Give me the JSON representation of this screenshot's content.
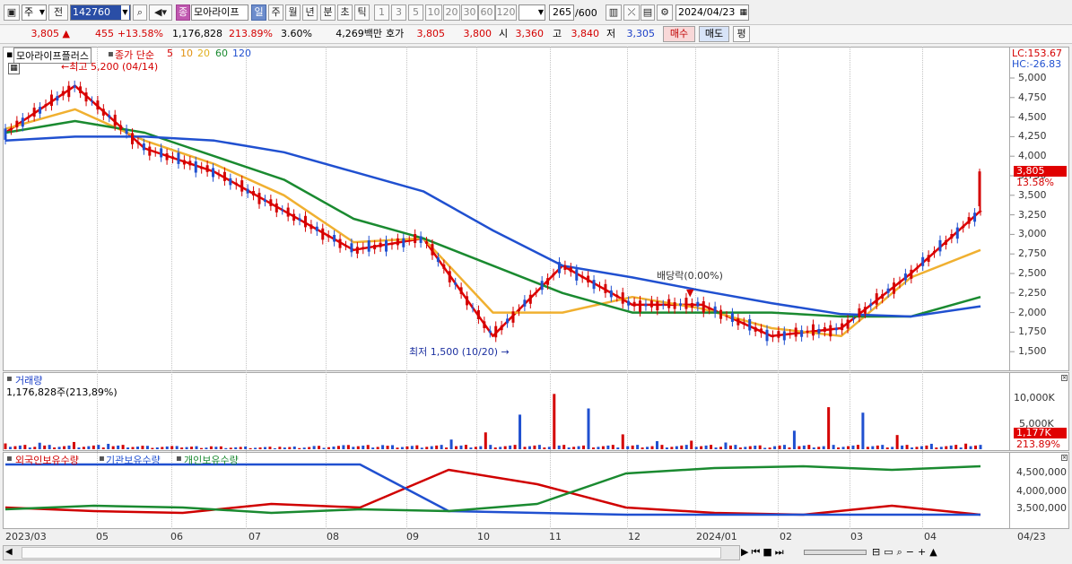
{
  "toolbar": {
    "period_select": "주",
    "prev_label": "전",
    "code": "142760",
    "name": "모아라이프",
    "badge": "종",
    "periods": [
      "일",
      "주",
      "월",
      "년",
      "분",
      "초",
      "틱"
    ],
    "intervals": [
      "1",
      "3",
      "5",
      "10",
      "20",
      "30",
      "60",
      "120"
    ],
    "count": "265",
    "count_total": "/600",
    "date": "2024/04/23"
  },
  "quote": {
    "price": "3,805",
    "change_arrow": "▲",
    "change": "455",
    "change_pct": "+13.58%",
    "volume": "1,176,828",
    "vol_ratio": "213.89%",
    "turnover": "3.60%",
    "amount": "4,269백만",
    "ask_label": "호가",
    "ask": "3,805",
    "bid": "3,800",
    "open_label": "시",
    "open": "3,360",
    "high_label": "고",
    "high": "3,840",
    "low_label": "저",
    "low": "3,305",
    "buy_label": "매수",
    "sell_label": "매도",
    "eval_label": "평"
  },
  "main_chart": {
    "name_tag": "모아라이프플러스",
    "legend": "종가 단순",
    "ma_labels": [
      "5",
      "10",
      "20",
      "60",
      "120"
    ],
    "ma_colors": [
      "#e00000",
      "#f0a020",
      "#f0b030",
      "#1a8a30",
      "#2050d0"
    ],
    "lc": "LC:153.67",
    "hc": "HC:-26.83",
    "annot_high": "최고 5,200 (04/14)",
    "annot_low": "최저 1,500 (10/20)",
    "annot_div": "배당락(0.00%)",
    "price_tag": "3,805",
    "price_pct": "13.58%",
    "yticks": [
      "5,000",
      "4,750",
      "4,500",
      "4,250",
      "4,000",
      "3,750",
      "3,500",
      "3,250",
      "3,000",
      "2,750",
      "2,500",
      "2,250",
      "2,000",
      "1,750",
      "1,500"
    ]
  },
  "volume_chart": {
    "title": "거래량",
    "value": "1,176,828주(213,89%)",
    "yticks": [
      "10,000K",
      "5,000K"
    ],
    "tag": "1,177K",
    "tag_pct": "213.89%"
  },
  "holding_chart": {
    "legend": [
      "외국인보유수량",
      "기관보유수량",
      "개인보유수량"
    ],
    "legend_colors": [
      "#d00000",
      "#2050d0",
      "#1a8a30"
    ],
    "yticks": [
      "4,500,000",
      "4,000,000",
      "3,500,000"
    ]
  },
  "x_labels": [
    "2023/03",
    "05",
    "06",
    "07",
    "08",
    "09",
    "10",
    "11",
    "12",
    "2024/01",
    "02",
    "03",
    "04"
  ],
  "x_end": "04/23",
  "chart_data": [
    {
      "type": "line",
      "title": "",
      "x": [
        "2023/03",
        "2023/04",
        "2023/05",
        "2023/06",
        "2023/07",
        "2023/08",
        "2023/09",
        "2023/10",
        "2023/11",
        "2023/12",
        "2024/01",
        "2024/02",
        "2024/03",
        "2024/04",
        "2024/04/23"
      ],
      "series": [
        {
          "name": "5",
          "values": [
            4300,
            4900,
            4100,
            3800,
            3300,
            2800,
            2950,
            1700,
            2600,
            2100,
            2100,
            1700,
            1800,
            2500,
            3300
          ]
        },
        {
          "name": "20",
          "values": [
            4350,
            4600,
            4200,
            3900,
            3500,
            2900,
            2950,
            2000,
            2000,
            2200,
            2050,
            1800,
            1700,
            2450,
            2800
          ]
        },
        {
          "name": "60",
          "values": [
            4300,
            4450,
            4300,
            4000,
            3700,
            3200,
            2950,
            2600,
            2250,
            2000,
            2000,
            2000,
            1950,
            1950,
            2200
          ]
        },
        {
          "name": "120",
          "values": [
            4200,
            4250,
            4250,
            4200,
            4050,
            3800,
            3550,
            3050,
            2600,
            2450,
            2280,
            2120,
            1980,
            1950,
            2080
          ]
        }
      ],
      "ylim": [
        1300,
        5100
      ]
    },
    {
      "type": "bar",
      "title": "거래량",
      "x": [
        "2023/03",
        "2023/04",
        "2023/05",
        "2023/06",
        "2023/07",
        "2023/08",
        "2023/09",
        "2023/10",
        "2023/11",
        "2023/12",
        "2024/01",
        "2024/02",
        "2024/03",
        "2024/04",
        "2024/04/23"
      ],
      "values": [
        1200,
        1500,
        700,
        600,
        500,
        900,
        800,
        3800,
        12500,
        1600,
        1800,
        600,
        10500,
        1100,
        1177
      ],
      "ylim": [
        0,
        13000
      ]
    },
    {
      "type": "line",
      "title": "",
      "x": [
        "2023/03",
        "2023/05",
        "2023/07",
        "2023/08",
        "2023/09",
        "2023/10",
        "2023/11",
        "2023/12",
        "2024/01",
        "2024/02",
        "2024/03",
        "2024/04"
      ],
      "series": [
        {
          "name": "외국인보유수량",
          "values": [
            3500000,
            3400000,
            3350000,
            3600000,
            3500000,
            4550000,
            4150000,
            3500000,
            3350000,
            3300000,
            3550000,
            3300000
          ]
        },
        {
          "name": "기관보유수량",
          "values": [
            4700000,
            4700000,
            4700000,
            4700000,
            4700000,
            3400000,
            3350000,
            3300000,
            3300000,
            3300000,
            3300000,
            3300000
          ]
        },
        {
          "name": "개인보유수량",
          "values": [
            3450000,
            3550000,
            3500000,
            3350000,
            3450000,
            3400000,
            3600000,
            4450000,
            4600000,
            4650000,
            4550000,
            4650000
          ]
        }
      ],
      "ylim": [
        3200000,
        4800000
      ]
    }
  ]
}
